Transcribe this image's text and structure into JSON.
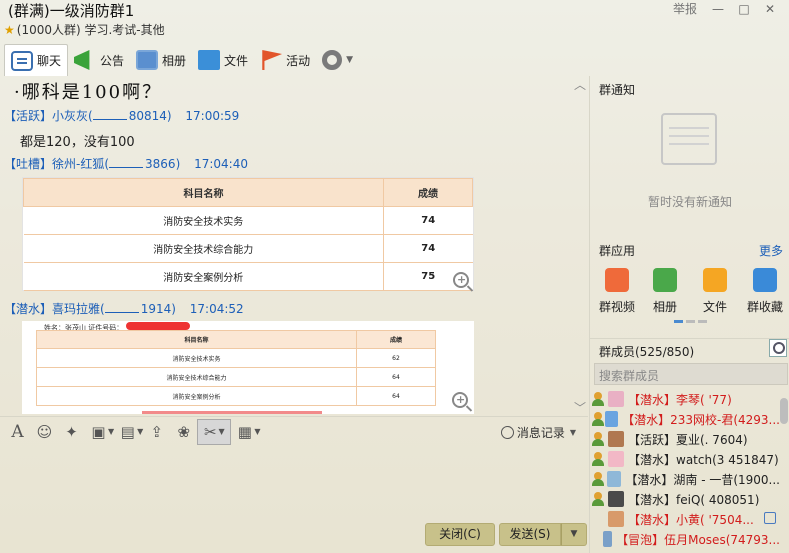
{
  "window": {
    "group_name": "(群满)一级消防群1",
    "subtitle": "(1000人群) 学习.考试-其他",
    "report": "举报",
    "minimize": "—",
    "maximize": "□",
    "close": "✕"
  },
  "toolbar": {
    "chat": "聊天",
    "notice": "公告",
    "album": "相册",
    "file": "文件",
    "activity": "活动"
  },
  "chat": {
    "top_message": "·哪科是100啊？",
    "messages": [
      {
        "tag": "【活跃】",
        "name": "小灰灰(",
        "uid_tail": "80814)",
        "time": "17:00:59",
        "text": "都是120，没有100"
      },
      {
        "tag": "【吐槽】",
        "name": "徐州-红狐(",
        "uid_tail": "3866)",
        "time": "17:04:40"
      },
      {
        "tag": "【潜水】",
        "name": "喜玛拉雅(",
        "uid_tail": "1914)",
        "time": "17:04:52"
      }
    ],
    "table1": {
      "headers": [
        "科目名称",
        "成绩"
      ],
      "rows": [
        [
          "消防安全技术实务",
          "74"
        ],
        [
          "消防安全技术综合能力",
          "74"
        ],
        [
          "消防安全案例分析",
          "75"
        ]
      ]
    },
    "table2": {
      "cert_line": "姓名：张茂山    证件号码：",
      "headers": [
        "科目名称",
        "成绩"
      ],
      "rows": [
        [
          "消防安全技术实务",
          "62"
        ],
        [
          "消防安全技术综合能力",
          "64"
        ],
        [
          "消防安全案例分析",
          "64"
        ]
      ]
    }
  },
  "input_toolbar": {
    "history": "消息记录"
  },
  "buttons": {
    "close": "关闭(C)",
    "send": "发送(S)"
  },
  "right_panel": {
    "notice_header": "群通知",
    "notice_empty": "暂时没有新通知",
    "apps_header": "群应用",
    "apps_more": "更多",
    "apps": [
      {
        "label": "群视频",
        "color": "#ef6a3a"
      },
      {
        "label": "相册",
        "color": "#4aa84a"
      },
      {
        "label": "文件",
        "color": "#f5a623"
      },
      {
        "label": "群收藏",
        "color": "#3a8ad8"
      }
    ],
    "members_header": "群成员(525/850)",
    "search_placeholder": "搜索群成员",
    "members": [
      {
        "text": "【潜水】李琴(   '77)",
        "color": "red"
      },
      {
        "text": "【潜水】233网校-君(4293...",
        "color": "red"
      },
      {
        "text": "【活跃】夏业(.       7604)",
        "color": "dark"
      },
      {
        "text": "【潜水】watch(3     451847)",
        "color": "dark"
      },
      {
        "text": "【潜水】湖南 - 一昔(1900...",
        "color": "dark"
      },
      {
        "text": "【潜水】feiQ(      408051)",
        "color": "dark"
      },
      {
        "text": "【潜水】小黄(    '7504...",
        "color": "red"
      },
      {
        "text": "【冒泡】伍月Moses(74793...",
        "color": "red"
      }
    ]
  },
  "colors": {
    "accent_blue": "#1d5fb8",
    "member_red": "#d21c1c",
    "button_bg": "#c8c18a"
  }
}
